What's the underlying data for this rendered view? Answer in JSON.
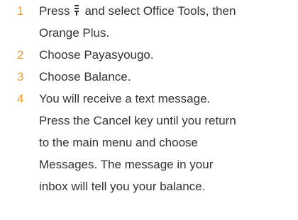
{
  "steps": [
    {
      "number": "1",
      "lines": [
        {
          "before_icon": "Press",
          "icon": "menu-key-icon",
          "after_icon": "and select Office Tools, then"
        },
        {
          "text": "Orange Plus."
        }
      ]
    },
    {
      "number": "2",
      "lines": [
        {
          "text": "Choose Payasyougo."
        }
      ]
    },
    {
      "number": "3",
      "lines": [
        {
          "text": "Choose Balance."
        }
      ]
    },
    {
      "number": "4",
      "lines": [
        {
          "text": "You will receive a text message."
        },
        {
          "text": "Press the Cancel key until you return"
        },
        {
          "text": "to the main menu and choose"
        },
        {
          "text": "Messages. The message in your"
        },
        {
          "text": "inbox will tell you your balance."
        }
      ]
    }
  ],
  "colors": {
    "step_number": "#f39a2e",
    "body_text": "#333333"
  }
}
